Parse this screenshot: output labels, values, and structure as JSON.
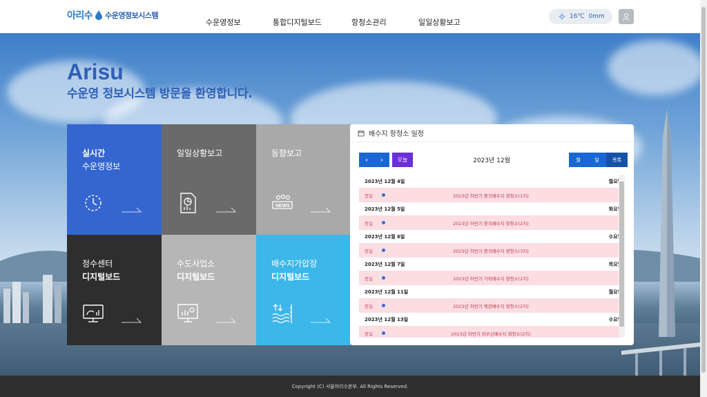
{
  "header": {
    "logo_ari": "아리수",
    "logo_system": "수운영정보시스템",
    "nav": [
      {
        "label": "수운영정보"
      },
      {
        "label": "통합디지털보드"
      },
      {
        "label": "항청소관리"
      },
      {
        "label": "일일상황보고"
      }
    ],
    "weather": {
      "temp": "16℃",
      "rain": "0mm"
    }
  },
  "hero": {
    "title": "Arisu",
    "subtitle": "수운영 정보시스템 방문을 환영합니다."
  },
  "tiles": [
    {
      "line1": "실시간",
      "line2": "수운영정보",
      "color": "#3566d0",
      "icon": "clock-icon"
    },
    {
      "line1": "일일상황보고",
      "line2": "",
      "color": "#6a6a6a",
      "icon": "report-icon"
    },
    {
      "line1": "동향보고",
      "line2": "",
      "color": "#a9a9a9",
      "icon": "news-icon"
    },
    {
      "line1": "정수센터",
      "line2": "디지털보드",
      "color": "#2e2e2e",
      "icon": "monitor-icon"
    },
    {
      "line1": "수도사업소",
      "line2": "디지털보드",
      "color": "#b6b6b6",
      "icon": "board-icon"
    },
    {
      "line1": "배수지가압장",
      "line2": "디지털보드",
      "color": "#3db6ea",
      "icon": "water-level-icon"
    }
  ],
  "schedule": {
    "title": "배수지 항청소 일정",
    "prev": "‹",
    "next": "›",
    "today": "오늘",
    "month": "2023년 12월",
    "views": [
      {
        "label": "월"
      },
      {
        "label": "일"
      },
      {
        "label": "목록"
      }
    ],
    "days": [
      {
        "date": "2023년 12월 4일",
        "weekday": "월요일",
        "allday": "종일",
        "event": "2023년 하반기 중곡배수지 항청소(1지)"
      },
      {
        "date": "2023년 12월 5일",
        "weekday": "화요일",
        "allday": "종일",
        "event": "2023년 하반기 중곡배수지 항청소(2지)"
      },
      {
        "date": "2023년 12월 6일",
        "weekday": "수요일",
        "allday": "종일",
        "event": "2023년 하반기 중곡배수지 항청소(3지)"
      },
      {
        "date": "2023년 12월 7일",
        "weekday": "목요일",
        "allday": "종일",
        "event": "2023년 하반기 가좌배수지 항청소(2지)"
      },
      {
        "date": "2023년 12월 11일",
        "weekday": "월요일",
        "allday": "종일",
        "event": "2023년 하반기 백련배수지 항청소(2지)"
      },
      {
        "date": "2023년 12월 13일",
        "weekday": "수요일",
        "allday": "종일",
        "event": "2023년 하반기 와우산배수지 항청소(2지)"
      }
    ]
  },
  "footer": {
    "copyright": "Copyright (C) 서울아리수본부. All Rights Reserved."
  }
}
